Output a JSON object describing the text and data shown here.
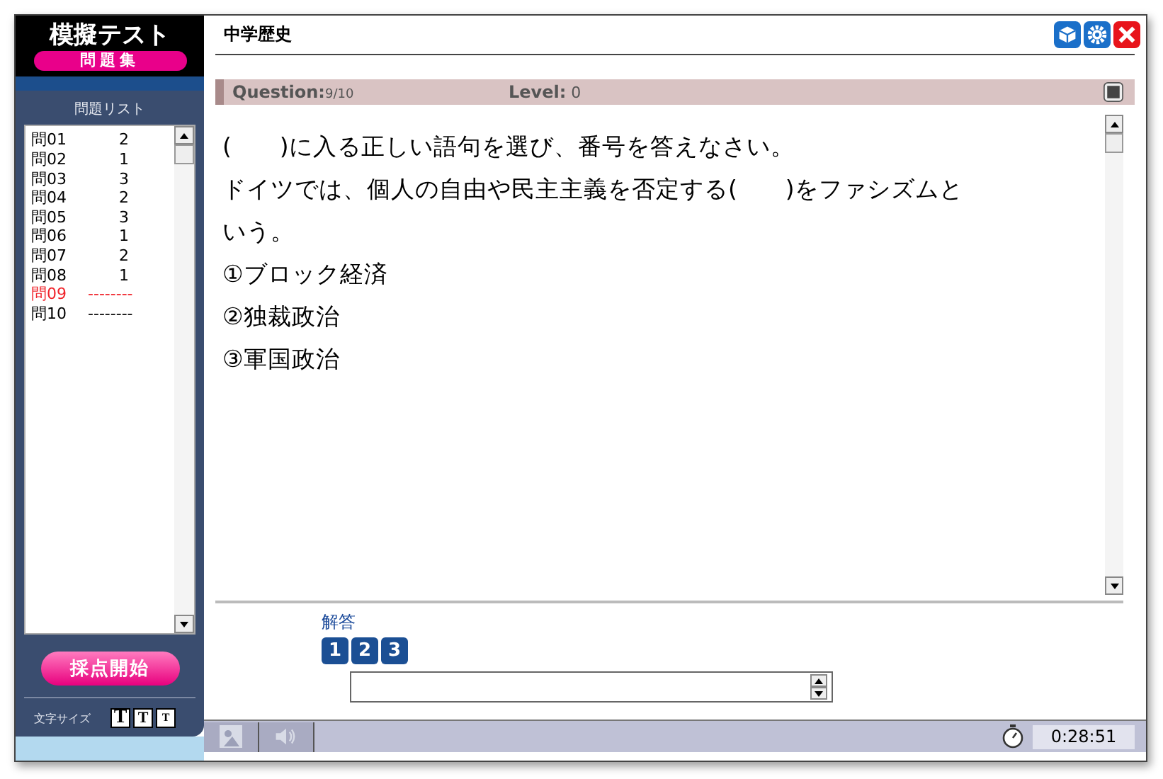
{
  "logo": {
    "title": "模擬テスト",
    "subtitle": "問題集"
  },
  "sidebar": {
    "title": "問題リスト",
    "items": [
      {
        "label": "問01",
        "answer": "2",
        "selected": false
      },
      {
        "label": "問02",
        "answer": "1",
        "selected": false
      },
      {
        "label": "問03",
        "answer": "3",
        "selected": false
      },
      {
        "label": "問04",
        "answer": "2",
        "selected": false
      },
      {
        "label": "問05",
        "answer": "3",
        "selected": false
      },
      {
        "label": "問06",
        "answer": "1",
        "selected": false
      },
      {
        "label": "問07",
        "answer": "2",
        "selected": false
      },
      {
        "label": "問08",
        "answer": "1",
        "selected": false
      },
      {
        "label": "問09",
        "answer": "--------",
        "selected": true
      },
      {
        "label": "問10",
        "answer": "--------",
        "selected": false
      }
    ],
    "grade_button": "採点開始",
    "font_size_label": "文字サイズ",
    "font_sizes": [
      "T",
      "T",
      "T"
    ]
  },
  "header": {
    "title": "中学歴史"
  },
  "question_bar": {
    "question_label": "Question:",
    "question_value": "9/10",
    "level_label": "Level:",
    "level_value": "0"
  },
  "question_lines": [
    "(　　)に入る正しい語句を選び、番号を答えなさい。",
    "ドイツでは、個人の自由や民主主義を否定する(　　)をファシズムと",
    "いう。",
    "①ブロック経済",
    "②独裁政治",
    "③軍国政治"
  ],
  "answer": {
    "label": "解答",
    "choices": [
      "1",
      "2",
      "3"
    ]
  },
  "status_bar": {
    "timer": "0:28:51"
  }
}
